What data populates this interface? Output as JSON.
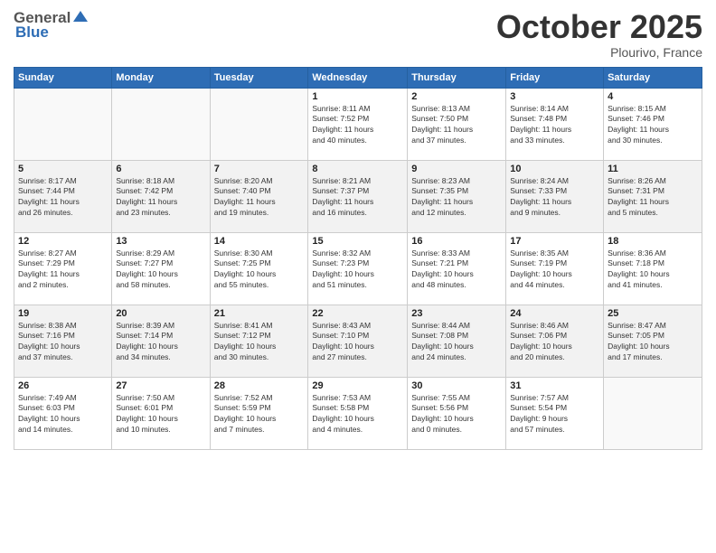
{
  "header": {
    "logo_general": "General",
    "logo_blue": "Blue",
    "month_title": "October 2025",
    "location": "Plourivo, France"
  },
  "days_of_week": [
    "Sunday",
    "Monday",
    "Tuesday",
    "Wednesday",
    "Thursday",
    "Friday",
    "Saturday"
  ],
  "weeks": [
    [
      {
        "day": "",
        "info": ""
      },
      {
        "day": "",
        "info": ""
      },
      {
        "day": "",
        "info": ""
      },
      {
        "day": "1",
        "info": "Sunrise: 8:11 AM\nSunset: 7:52 PM\nDaylight: 11 hours\nand 40 minutes."
      },
      {
        "day": "2",
        "info": "Sunrise: 8:13 AM\nSunset: 7:50 PM\nDaylight: 11 hours\nand 37 minutes."
      },
      {
        "day": "3",
        "info": "Sunrise: 8:14 AM\nSunset: 7:48 PM\nDaylight: 11 hours\nand 33 minutes."
      },
      {
        "day": "4",
        "info": "Sunrise: 8:15 AM\nSunset: 7:46 PM\nDaylight: 11 hours\nand 30 minutes."
      }
    ],
    [
      {
        "day": "5",
        "info": "Sunrise: 8:17 AM\nSunset: 7:44 PM\nDaylight: 11 hours\nand 26 minutes."
      },
      {
        "day": "6",
        "info": "Sunrise: 8:18 AM\nSunset: 7:42 PM\nDaylight: 11 hours\nand 23 minutes."
      },
      {
        "day": "7",
        "info": "Sunrise: 8:20 AM\nSunset: 7:40 PM\nDaylight: 11 hours\nand 19 minutes."
      },
      {
        "day": "8",
        "info": "Sunrise: 8:21 AM\nSunset: 7:37 PM\nDaylight: 11 hours\nand 16 minutes."
      },
      {
        "day": "9",
        "info": "Sunrise: 8:23 AM\nSunset: 7:35 PM\nDaylight: 11 hours\nand 12 minutes."
      },
      {
        "day": "10",
        "info": "Sunrise: 8:24 AM\nSunset: 7:33 PM\nDaylight: 11 hours\nand 9 minutes."
      },
      {
        "day": "11",
        "info": "Sunrise: 8:26 AM\nSunset: 7:31 PM\nDaylight: 11 hours\nand 5 minutes."
      }
    ],
    [
      {
        "day": "12",
        "info": "Sunrise: 8:27 AM\nSunset: 7:29 PM\nDaylight: 11 hours\nand 2 minutes."
      },
      {
        "day": "13",
        "info": "Sunrise: 8:29 AM\nSunset: 7:27 PM\nDaylight: 10 hours\nand 58 minutes."
      },
      {
        "day": "14",
        "info": "Sunrise: 8:30 AM\nSunset: 7:25 PM\nDaylight: 10 hours\nand 55 minutes."
      },
      {
        "day": "15",
        "info": "Sunrise: 8:32 AM\nSunset: 7:23 PM\nDaylight: 10 hours\nand 51 minutes."
      },
      {
        "day": "16",
        "info": "Sunrise: 8:33 AM\nSunset: 7:21 PM\nDaylight: 10 hours\nand 48 minutes."
      },
      {
        "day": "17",
        "info": "Sunrise: 8:35 AM\nSunset: 7:19 PM\nDaylight: 10 hours\nand 44 minutes."
      },
      {
        "day": "18",
        "info": "Sunrise: 8:36 AM\nSunset: 7:18 PM\nDaylight: 10 hours\nand 41 minutes."
      }
    ],
    [
      {
        "day": "19",
        "info": "Sunrise: 8:38 AM\nSunset: 7:16 PM\nDaylight: 10 hours\nand 37 minutes."
      },
      {
        "day": "20",
        "info": "Sunrise: 8:39 AM\nSunset: 7:14 PM\nDaylight: 10 hours\nand 34 minutes."
      },
      {
        "day": "21",
        "info": "Sunrise: 8:41 AM\nSunset: 7:12 PM\nDaylight: 10 hours\nand 30 minutes."
      },
      {
        "day": "22",
        "info": "Sunrise: 8:43 AM\nSunset: 7:10 PM\nDaylight: 10 hours\nand 27 minutes."
      },
      {
        "day": "23",
        "info": "Sunrise: 8:44 AM\nSunset: 7:08 PM\nDaylight: 10 hours\nand 24 minutes."
      },
      {
        "day": "24",
        "info": "Sunrise: 8:46 AM\nSunset: 7:06 PM\nDaylight: 10 hours\nand 20 minutes."
      },
      {
        "day": "25",
        "info": "Sunrise: 8:47 AM\nSunset: 7:05 PM\nDaylight: 10 hours\nand 17 minutes."
      }
    ],
    [
      {
        "day": "26",
        "info": "Sunrise: 7:49 AM\nSunset: 6:03 PM\nDaylight: 10 hours\nand 14 minutes."
      },
      {
        "day": "27",
        "info": "Sunrise: 7:50 AM\nSunset: 6:01 PM\nDaylight: 10 hours\nand 10 minutes."
      },
      {
        "day": "28",
        "info": "Sunrise: 7:52 AM\nSunset: 5:59 PM\nDaylight: 10 hours\nand 7 minutes."
      },
      {
        "day": "29",
        "info": "Sunrise: 7:53 AM\nSunset: 5:58 PM\nDaylight: 10 hours\nand 4 minutes."
      },
      {
        "day": "30",
        "info": "Sunrise: 7:55 AM\nSunset: 5:56 PM\nDaylight: 10 hours\nand 0 minutes."
      },
      {
        "day": "31",
        "info": "Sunrise: 7:57 AM\nSunset: 5:54 PM\nDaylight: 9 hours\nand 57 minutes."
      },
      {
        "day": "",
        "info": ""
      }
    ]
  ]
}
